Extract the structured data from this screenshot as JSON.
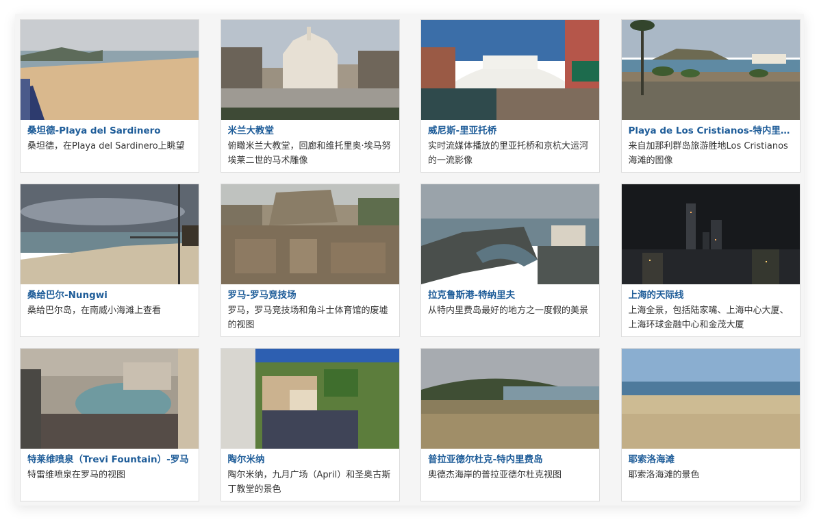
{
  "cards": [
    {
      "title": "桑坦德-Playa del Sardinero",
      "description": "桑坦德，在Playa del Sardinero上眺望"
    },
    {
      "title": "米兰大教堂",
      "description": "俯瞰米兰大教堂，回廊和维托里奥·埃马努埃莱二世的马术雕像"
    },
    {
      "title": "威尼斯-里亚托桥",
      "description": "实时流媒体播放的里亚托桥和京杭大运河的一流影像"
    },
    {
      "title": "Playa de Los Cristianos-特内里费岛",
      "description": "来自加那利群岛旅游胜地Los Cristianos海滩的图像"
    },
    {
      "title": "桑给巴尔-Nungwi",
      "description": "桑给巴尔岛，在南威小海滩上查看"
    },
    {
      "title": "罗马-罗马竞技场",
      "description": "罗马，罗马竞技场和角斗士体育馆的废墟的视图"
    },
    {
      "title": "拉克鲁斯港-特纳里夫",
      "description": "从特内里费岛最好的地方之一度假的美景"
    },
    {
      "title": "上海的天际线",
      "description": "上海全景，包括陆家嘴、上海中心大厦、上海环球金融中心和金茂大厦"
    },
    {
      "title": "特莱维喷泉（Trevi Fountain）-罗马",
      "description": "特雷维喷泉在罗马的视图"
    },
    {
      "title": "陶尔米纳",
      "description": "陶尔米纳，九月广场（April）和圣奥古斯丁教堂的景色"
    },
    {
      "title": "普拉亚德尔杜克-特内里费岛",
      "description": "奥德杰海岸的普拉亚德尔杜克视图"
    },
    {
      "title": "耶索洛海滩",
      "description": "耶索洛海滩的景色"
    }
  ],
  "colors": {
    "title": "#1f5d99",
    "description": "#333333"
  }
}
